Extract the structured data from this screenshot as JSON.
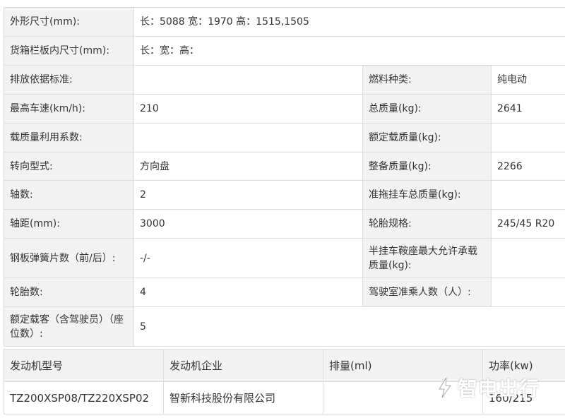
{
  "spec": {
    "dimensions": {
      "label": "外形尺寸(mm):",
      "value": "长：5088 宽：1970 高：1515,1505"
    },
    "cargo_box": {
      "label": "货箱栏板内尺寸(mm):",
      "value": "长：宽：高："
    },
    "rows": [
      {
        "l1": "排放依据标准:",
        "v1": "",
        "l2": "燃料种类:",
        "v2": "纯电动"
      },
      {
        "l1": "最高车速(km/h):",
        "v1": "210",
        "l2": "总质量(kg):",
        "v2": "2641"
      },
      {
        "l1": "载质量利用系数:",
        "v1": "",
        "l2": "额定载质量(kg):",
        "v2": ""
      },
      {
        "l1": "转向型式:",
        "v1": "方向盘",
        "l2": "整备质量(kg):",
        "v2": "2266"
      },
      {
        "l1": "轴数:",
        "v1": "2",
        "l2": "准拖挂车总质量(kg):",
        "v2": ""
      },
      {
        "l1": "轴距(mm):",
        "v1": "3000",
        "l2": "轮胎规格:",
        "v2": "245/45 R20"
      },
      {
        "l1": "钢板弹簧片数（前/后）:",
        "v1": "-/-",
        "l2": "半挂车鞍座最大允许承载质量(kg):",
        "v2": ""
      },
      {
        "l1": "轮胎数:",
        "v1": "4",
        "l2": "驾驶室准乘人数（人）:",
        "v2": ""
      }
    ],
    "passengers": {
      "label": "额定载客（含驾驶员）（座位数）:",
      "value": "5"
    }
  },
  "engine": {
    "headers": [
      "发动机型号",
      "发动机企业",
      "排量(ml)",
      "功率(kw)"
    ],
    "row": [
      "TZ200XSP08/TZ220XSP02",
      "智新科技股份有限公司",
      "",
      "160/215"
    ]
  },
  "watermark": {
    "text": "智电出行"
  },
  "colors": {
    "label_bg": "#f2f2f2",
    "border": "#dcdcdc",
    "text": "#333333"
  }
}
